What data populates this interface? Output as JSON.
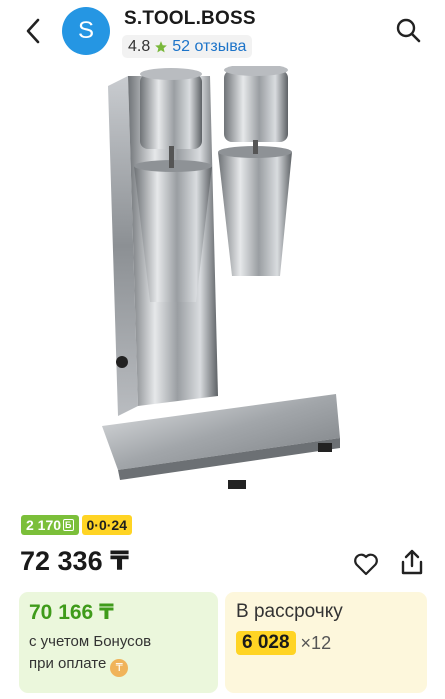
{
  "header": {
    "avatar_letter": "S",
    "store_name": "S.TOOL.BOSS",
    "rating": "4.8",
    "reviews": "52 отзыва"
  },
  "badges": {
    "bonus": "2 170",
    "installment": "0·0·24"
  },
  "price": "72 336 ₸",
  "bonus_card": {
    "price": "70 166 ₸",
    "line1": "с учетом Бонусов",
    "line2": "при оплате"
  },
  "installment_card": {
    "title": "В рассрочку",
    "amount": "6 028",
    "months": "×12"
  },
  "colors": {
    "accent_blue": "#2596e3",
    "bonus_green": "#7bbf3a",
    "installment_yellow": "#ffd424",
    "price_green": "#3f9b1a"
  },
  "icons": [
    "back-icon",
    "search-icon",
    "star-icon",
    "heart-icon",
    "share-icon",
    "coin-icon"
  ]
}
